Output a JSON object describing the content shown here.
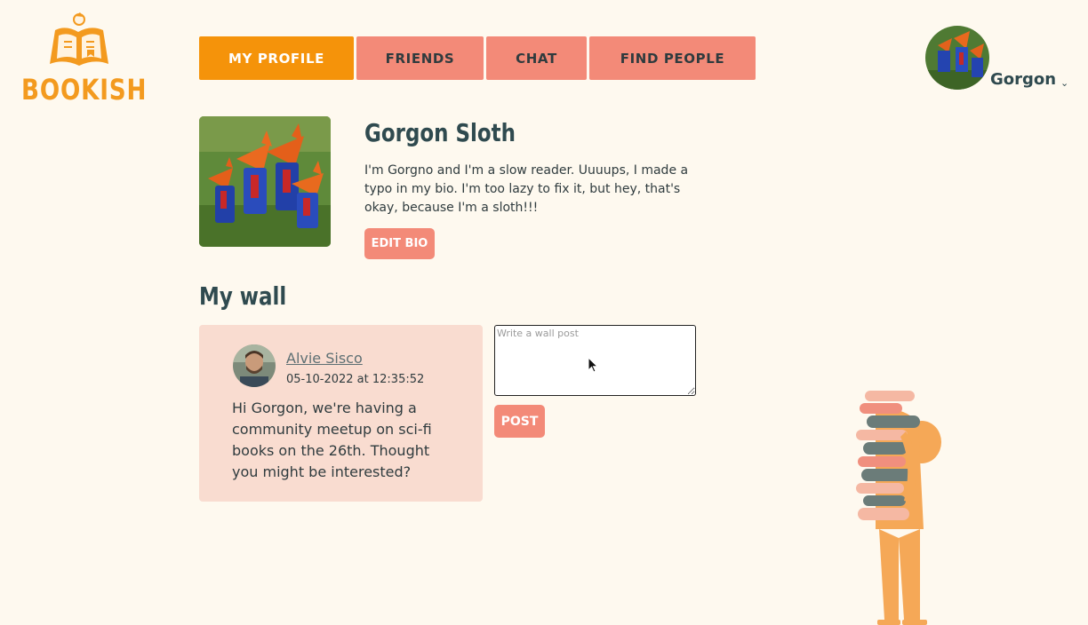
{
  "app": {
    "logo_text": "BOOKISH"
  },
  "nav": {
    "items": [
      {
        "label": "MY PROFILE",
        "active": true
      },
      {
        "label": "FRIENDS",
        "active": false
      },
      {
        "label": "CHAT",
        "active": false
      },
      {
        "label": "FIND PEOPLE",
        "active": false
      }
    ]
  },
  "user_menu": {
    "name": "Gorgon",
    "chevron": "⌄"
  },
  "profile": {
    "name": "Gorgon Sloth",
    "bio": "I'm Gorgno and I'm a slow reader. Uuuups, I made a typo in my bio. I'm too lazy to fix it, but hey, that's okay, because I'm a sloth!!!",
    "edit_label": "EDIT BIO"
  },
  "wall": {
    "title": "My wall",
    "posts": [
      {
        "author": "Alvie Sisco",
        "date": "05-10-2022 at 12:35:52",
        "text": "Hi Gorgon, we're having a community meetup on sci-fi books on the 26th. Thought you might be interested?"
      }
    ],
    "composer": {
      "placeholder": "Write a wall post",
      "value": "",
      "button_label": "POST"
    }
  },
  "colors": {
    "background": "#fef9ef",
    "primary": "#f5930a",
    "button": "#f38a78",
    "card": "#f9dcd0",
    "text": "#2f4a4f"
  }
}
